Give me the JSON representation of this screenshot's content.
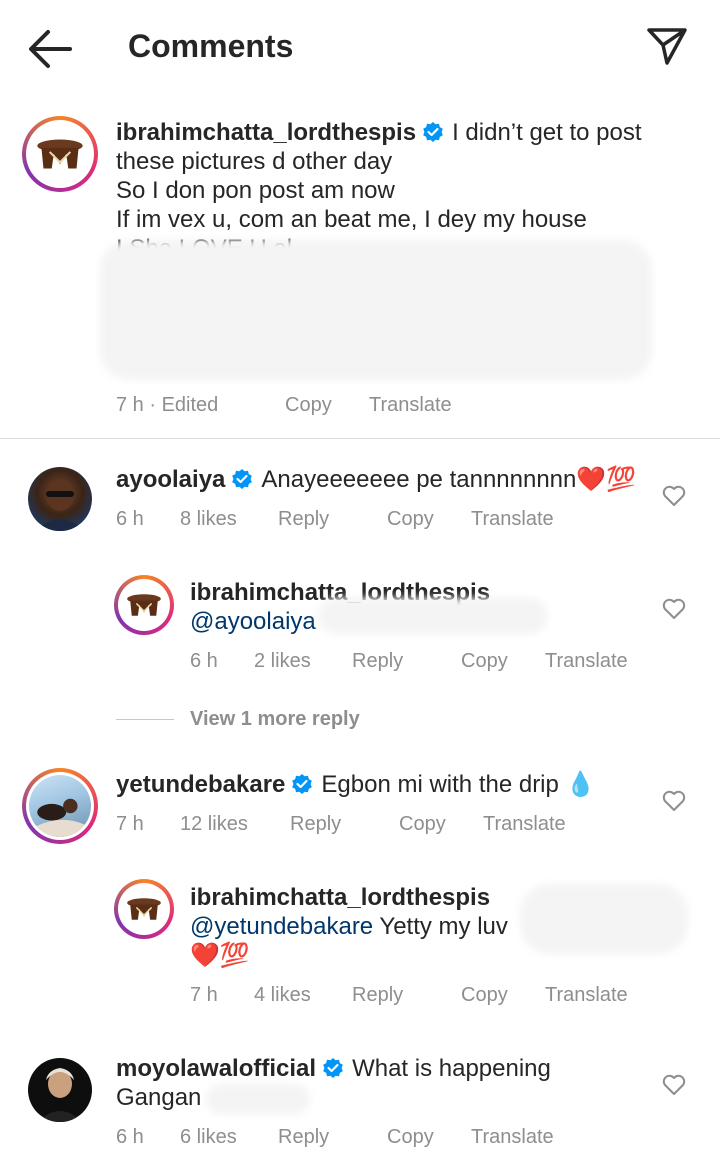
{
  "header": {
    "title": "Comments",
    "back_icon": "arrow-left-icon",
    "send_icon": "paper-plane-icon"
  },
  "caption": {
    "username": "ibrahimchatta_lordthespis",
    "line1": "I didn’t get to post",
    "line2": "these pictures d other day",
    "line3": "So I don pon post am now",
    "line4": "If im vex u, com an beat me, I dey my house",
    "line5": "I Sha LOVE U al.",
    "time": "7 h · Edited",
    "copy": "Copy",
    "translate": "Translate"
  },
  "comments": [
    {
      "username": "ayoolaiya",
      "text": "Anayeeeeeee pe tannnnnnnn",
      "emoji": "❤️💯",
      "time": "6 h",
      "likes": "8 likes",
      "reply": "Reply",
      "copy": "Copy",
      "translate": "Translate"
    },
    {
      "username": "ibrahimchatta_lordthespis",
      "mention": "@ayoolaiya",
      "time": "6 h",
      "likes": "2 likes",
      "reply": "Reply",
      "copy": "Copy",
      "translate": "Translate"
    },
    {
      "username": "yetundebakare",
      "text": "Egbon mi with the drip",
      "emoji": "💧",
      "time": "7 h",
      "likes": "12 likes",
      "reply": "Reply",
      "copy": "Copy",
      "translate": "Translate"
    },
    {
      "username": "ibrahimchatta_lordthespis",
      "mention": "@yetundebakare",
      "text": "Yetty my luv",
      "emoji": "❤️💯",
      "time": "7 h",
      "likes": "4 likes",
      "reply": "Reply",
      "copy": "Copy",
      "translate": "Translate"
    },
    {
      "username": "moyolawalofficial",
      "text": "What is happening",
      "text2": "Gangan",
      "time": "6 h",
      "likes": "6 likes",
      "reply": "Reply",
      "copy": "Copy",
      "translate": "Translate"
    }
  ],
  "view_more": "View 1 more reply",
  "colors": {
    "verified": "#0095f6",
    "mention": "#00376b",
    "meta": "#8e8e8e",
    "text": "#262626"
  }
}
